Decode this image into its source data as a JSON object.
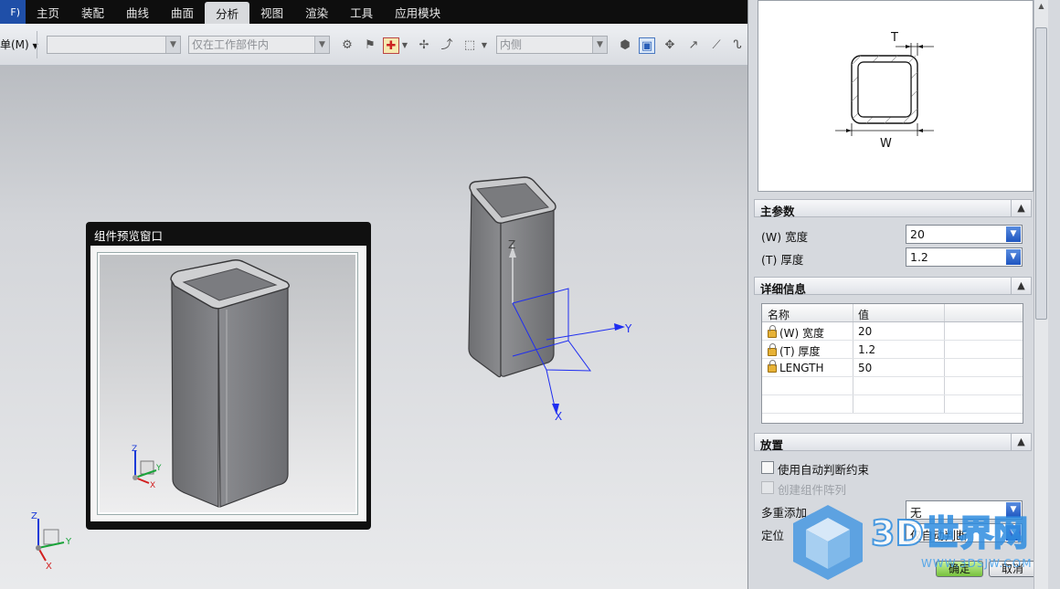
{
  "menubar": {
    "file_label": "F)",
    "tabs": [
      "主页",
      "装配",
      "曲线",
      "曲面",
      "分析",
      "视图",
      "渲染",
      "工具",
      "应用模块"
    ],
    "active_tab": "分析"
  },
  "toolbar": {
    "menu_label": "单(M)",
    "filter_combo": "",
    "scope_combo": "仅在工作部件内",
    "snap_combo": "内侧"
  },
  "viewport": {
    "axis_labels": {
      "x": "X",
      "y": "Y",
      "z": "Z"
    }
  },
  "preview_window": {
    "title": "组件预览窗口"
  },
  "panel": {
    "drawing_labels": {
      "t": "T",
      "w": "W"
    },
    "main_params": {
      "title": "主参数",
      "width_label": "(W) 宽度",
      "width_value": "20",
      "thickness_label": "(T) 厚度",
      "thickness_value": "1.2"
    },
    "details": {
      "title": "详细信息",
      "columns": [
        "名称",
        "值"
      ],
      "rows": [
        {
          "name": "(W) 宽度",
          "value": "20"
        },
        {
          "name": "(T) 厚度",
          "value": "1.2"
        },
        {
          "name": "LENGTH",
          "value": "50"
        }
      ]
    },
    "placement": {
      "title": "放置",
      "auto_constraint_label": "使用自动判断约束",
      "create_array_label": "创建组件阵列",
      "multi_add_label": "多重添加",
      "multi_add_value": "无",
      "position_label": "定位",
      "position_value": "仅自动判断"
    },
    "buttons": {
      "ok": "确定",
      "cancel": "取消"
    }
  },
  "watermark": {
    "brand": "3D世界网",
    "url": "WWW.3DSJW.COM"
  },
  "colors": {
    "menubar_bg": "#0e0e0e",
    "ok_green": "#77c23d",
    "dropdown_blue": "#1e55c0",
    "axis_blue": "#1f2ef0",
    "watermark_blue": "#2f8de0"
  }
}
